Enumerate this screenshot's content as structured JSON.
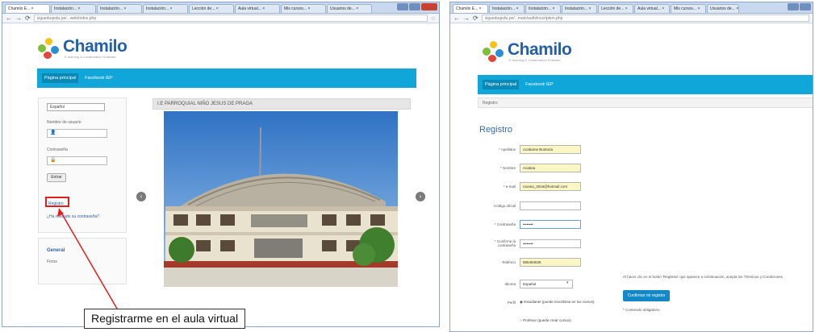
{
  "left": {
    "tabs": [
      "Chamilo E... ×",
      "Instalación... ×",
      "Instalación... ×",
      "Instalación... ×",
      "Lección de... ×",
      "Aula virtual... ×",
      "Mis cursos... ×",
      "Usuarios de... ×"
    ],
    "url": "sigueduqedu.pe/...web/index.php",
    "logo": {
      "title": "Chamilo",
      "subtitle": "E-learning & Collaboration Software"
    },
    "nav": [
      "Página principal",
      "Facebook IEP"
    ],
    "language_select": "Español",
    "username_label": "Nombre de usuario",
    "password_label": "Contraseña",
    "login_button": "Entrar",
    "register_link": "Registro",
    "lost_password_link": "¿Ha olvidado su contraseña?",
    "general_title": "General",
    "forum_link": "Foros",
    "carousel_title": "I.E PARROQUIAL NIÑO JESUS DE PRAGA",
    "callout": "Registrarme en el aula virtual"
  },
  "right": {
    "tabs": [
      "Chamilo E... ×",
      "Instalación... ×",
      "Instalación... ×",
      "Instalación... ×",
      "Lección de... ×",
      "Aula virtual... ×",
      "Mis cursos... ×",
      "Usuarios de... ×"
    ],
    "url": "sigueduqedu.pe/...main/auth/inscription.php",
    "logo": {
      "title": "Chamilo",
      "subtitle": "E-learning & Collaboration Software"
    },
    "nav": [
      "Página principal",
      "Facebook IEP"
    ],
    "breadcrumb": "Registro",
    "form_title": "Registro",
    "fields": [
      {
        "label": "* Apellidos",
        "value": "Acabame Bonturia"
      },
      {
        "label": "* Nombre",
        "value": "Acabea"
      },
      {
        "label": "* e-mail",
        "value": "roxana_3016@hotmail.com"
      },
      {
        "label": "Código oficial",
        "value": ""
      },
      {
        "label": "* Contraseña",
        "value": "••••••••"
      },
      {
        "label": "* Confirme la contraseña",
        "value": "••••••••"
      },
      {
        "label": "Teléfono",
        "value": "965494536"
      },
      {
        "label": "Idioma",
        "value": "Español"
      }
    ],
    "profile_label": "Perfil",
    "radio_student": "Estudiante (puede inscribirse en los cursos)",
    "radio_teacher": "Profesor (puede crear cursos)",
    "terms_text": "Al hacer clic en el botón 'Registrar' que aparece a continuación, acepta los Términos y Condiciones",
    "confirm_button": "Confirmar mi registro",
    "required_note": "* Contenido obligatorio"
  }
}
